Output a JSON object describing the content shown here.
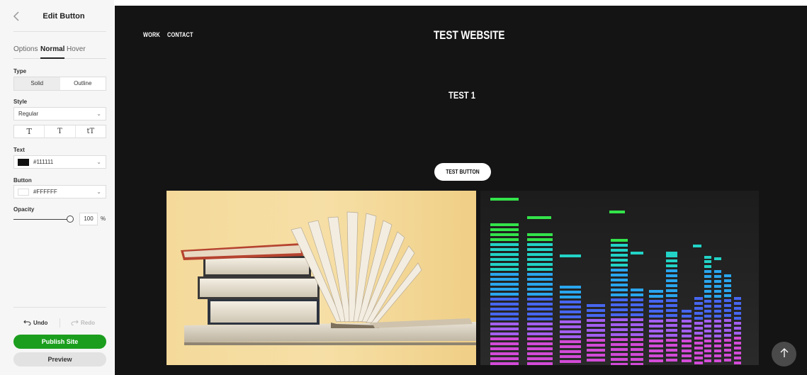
{
  "panel": {
    "title": "Edit Button",
    "tabs": [
      {
        "label": "Options"
      },
      {
        "label": "Normal"
      },
      {
        "label": "Hover"
      }
    ],
    "type": {
      "label": "Type",
      "options": [
        "Solid",
        "Outline"
      ],
      "selected": "Solid"
    },
    "style": {
      "label": "Style",
      "value": "Regular",
      "transforms": [
        "T",
        "T",
        "tT"
      ]
    },
    "text": {
      "label": "Text",
      "color_value": "#111111",
      "swatch_color": "#111111"
    },
    "button": {
      "label": "Button",
      "color_value": "#FFFFFF",
      "swatch_color": "#FFFFFF"
    },
    "opacity": {
      "label": "Opacity",
      "value": "100",
      "unit": "%",
      "level": 1.0
    },
    "undo_label": "Undo",
    "redo_label": "Redo",
    "publish_label": "Publish Site",
    "preview_label": "Preview"
  },
  "site": {
    "nav": [
      "WORK",
      "CONTACT"
    ],
    "title": "TEST WEBSITE",
    "section_heading": "TEST 1",
    "button_label": "TEST BUTTON",
    "scroll_top_icon": "arrow-up-icon"
  },
  "colors": {
    "accent_green": "#1b9e1e",
    "site_background": "#141414",
    "panel_background": "#f6f6f6"
  }
}
